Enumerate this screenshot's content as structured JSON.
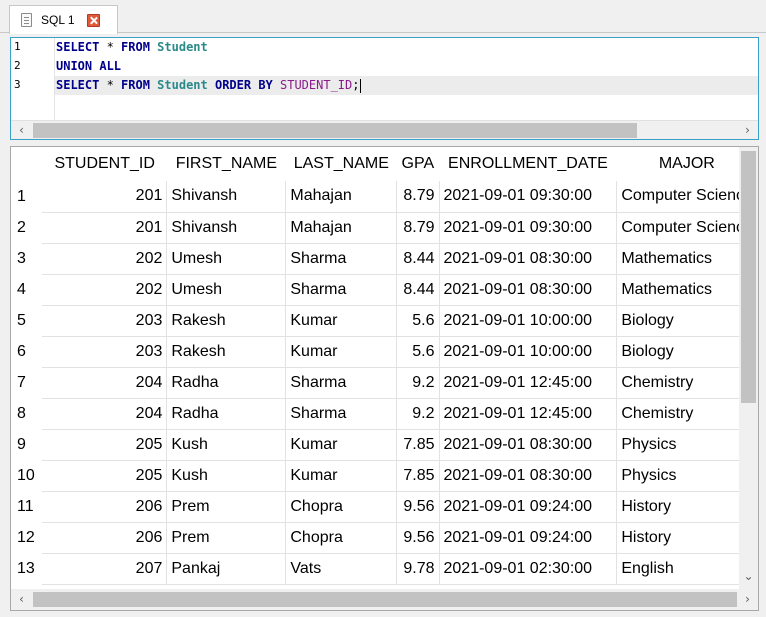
{
  "tab": {
    "label": "SQL 1"
  },
  "editor": {
    "line_numbers": [
      "1",
      "2",
      "3"
    ],
    "lines": [
      {
        "kw1": "SELECT",
        "op1": " * ",
        "kw2": "FROM",
        "tbl": " Student"
      },
      {
        "kw1": "UNION ALL"
      },
      {
        "kw1": "SELECT",
        "op1": " * ",
        "kw2": "FROM",
        "tbl": " Student",
        "kw3": " ORDER BY",
        "col": " STUDENT_ID",
        "end": ";"
      }
    ]
  },
  "grid": {
    "columns": [
      "STUDENT_ID",
      "FIRST_NAME",
      "LAST_NAME",
      "GPA",
      "ENROLLMENT_DATE",
      "MAJOR"
    ],
    "rows": [
      [
        "1",
        "201",
        "Shivansh",
        "Mahajan",
        "8.79",
        "2021-09-01 09:30:00",
        "Computer Science"
      ],
      [
        "2",
        "201",
        "Shivansh",
        "Mahajan",
        "8.79",
        "2021-09-01 09:30:00",
        "Computer Science"
      ],
      [
        "3",
        "202",
        "Umesh",
        "Sharma",
        "8.44",
        "2021-09-01 08:30:00",
        "Mathematics"
      ],
      [
        "4",
        "202",
        "Umesh",
        "Sharma",
        "8.44",
        "2021-09-01 08:30:00",
        "Mathematics"
      ],
      [
        "5",
        "203",
        "Rakesh",
        "Kumar",
        "5.6",
        "2021-09-01 10:00:00",
        "Biology"
      ],
      [
        "6",
        "203",
        "Rakesh",
        "Kumar",
        "5.6",
        "2021-09-01 10:00:00",
        "Biology"
      ],
      [
        "7",
        "204",
        "Radha",
        "Sharma",
        "9.2",
        "2021-09-01 12:45:00",
        "Chemistry"
      ],
      [
        "8",
        "204",
        "Radha",
        "Sharma",
        "9.2",
        "2021-09-01 12:45:00",
        "Chemistry"
      ],
      [
        "9",
        "205",
        "Kush",
        "Kumar",
        "7.85",
        "2021-09-01 08:30:00",
        "Physics"
      ],
      [
        "10",
        "205",
        "Kush",
        "Kumar",
        "7.85",
        "2021-09-01 08:30:00",
        "Physics"
      ],
      [
        "11",
        "206",
        "Prem",
        "Chopra",
        "9.56",
        "2021-09-01 09:24:00",
        "History"
      ],
      [
        "12",
        "206",
        "Prem",
        "Chopra",
        "9.56",
        "2021-09-01 09:24:00",
        "History"
      ],
      [
        "13",
        "207",
        "Pankaj",
        "Vats",
        "9.78",
        "2021-09-01 02:30:00",
        "English"
      ]
    ]
  },
  "icons": {
    "tab_icon": "sql-document-icon",
    "close": "close-icon",
    "scroll_left": "‹",
    "scroll_right": "›",
    "scroll_down": "⌄"
  },
  "colors": {
    "editor_border": "#3aa0c8",
    "keyword": "#00008b",
    "table_name": "#2a8a8a",
    "column_name": "#8b1a8b",
    "close_button": "#e05a3a"
  }
}
